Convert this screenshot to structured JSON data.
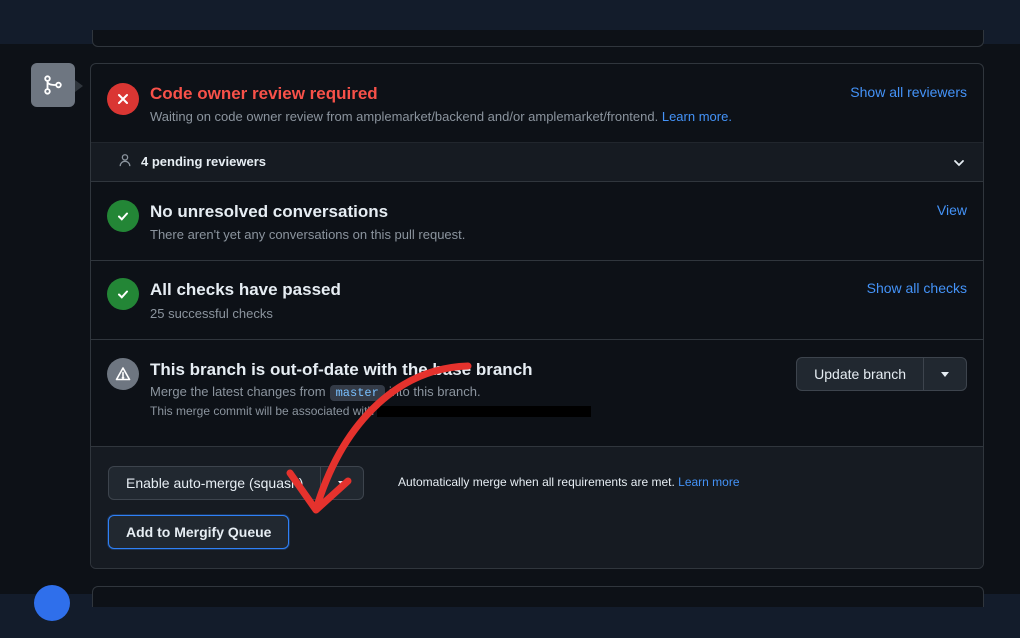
{
  "review": {
    "title": "Code owner review required",
    "description": "Waiting on code owner review from amplemarket/backend and/or amplemarket/frontend.",
    "learn_more": "Learn more.",
    "action": "Show all reviewers"
  },
  "pending": {
    "label": "4 pending reviewers"
  },
  "conversations": {
    "title": "No unresolved conversations",
    "description": "There aren't yet any conversations on this pull request.",
    "action": "View"
  },
  "checks": {
    "title": "All checks have passed",
    "description": "25 successful checks",
    "action": "Show all checks"
  },
  "branch": {
    "title": "This branch is out-of-date with the base branch",
    "desc_prefix": "Merge the latest changes from",
    "base_ref": "master",
    "desc_suffix": "into this branch.",
    "commit_note": "This merge commit will be associated with",
    "update_button": "Update branch"
  },
  "merge": {
    "auto_merge_button": "Enable auto-merge (squash)",
    "auto_merge_note": "Automatically merge when all requirements are met.",
    "learn_more": "Learn more",
    "mergify_button": "Add to Mergify Queue"
  },
  "colors": {
    "error": "#f85149",
    "success": "#238636",
    "link": "#4493f8",
    "annotation_arrow": "#e5322d"
  },
  "icons": {
    "merge_badge": "git-merge-icon",
    "review_status": "x-circle-icon",
    "conversations_status": "check-circle-icon",
    "checks_status": "check-circle-icon",
    "branch_status": "alert-triangle-icon",
    "pending": "person-icon",
    "expand": "chevron-down-icon"
  }
}
